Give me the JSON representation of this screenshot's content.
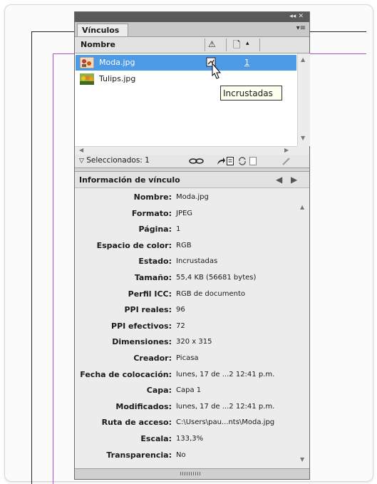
{
  "panel": {
    "tab_title": "Vínculos",
    "title_controls": "◂◂  ✕",
    "menu_icon": "▾≡",
    "columns": {
      "name": "Nombre",
      "warning_icon": "⚠",
      "page_icon": "🗋",
      "sort_icon": "▴"
    },
    "links": [
      {
        "name": "Moda.jpg",
        "page": "1",
        "selected": true
      },
      {
        "name": "Tulips.jpg",
        "page": "",
        "selected": false
      }
    ],
    "status": {
      "selected_label": "Seleccionados: 1"
    },
    "tooltip": "Incrustadas"
  },
  "info": {
    "title": "Información de vínculo",
    "rows": [
      {
        "key": "Nombre:",
        "value": "Moda.jpg"
      },
      {
        "key": "Formato:",
        "value": "JPEG"
      },
      {
        "key": "Página:",
        "value": "1"
      },
      {
        "key": "Espacio de color:",
        "value": "RGB"
      },
      {
        "key": "Estado:",
        "value": "Incrustadas"
      },
      {
        "key": "Tamaño:",
        "value": "55,4 KB (56681 bytes)"
      },
      {
        "key": "Perfil ICC:",
        "value": "RGB de documento"
      },
      {
        "key": "PPI reales:",
        "value": "96"
      },
      {
        "key": "PPI efectivos:",
        "value": "72"
      },
      {
        "key": "Dimensiones:",
        "value": "320 x 315"
      },
      {
        "key": "Creador:",
        "value": "Picasa"
      },
      {
        "key": "Fecha de colocación:",
        "value": "lunes, 17 de ...2 12:41 p.m."
      },
      {
        "key": "Capa:",
        "value": "Capa 1"
      },
      {
        "key": "Modificados:",
        "value": "lunes, 17 de ...2 12:41 p.m."
      },
      {
        "key": "Ruta de acceso:",
        "value": "C:\\Users\\pau...nts\\Moda.jpg"
      },
      {
        "key": "Escala:",
        "value": "133,3%"
      },
      {
        "key": "Transparencia:",
        "value": "No"
      }
    ]
  },
  "colors": {
    "selection": "#4d9ae6",
    "guide_magenta": "#b24bd8"
  }
}
